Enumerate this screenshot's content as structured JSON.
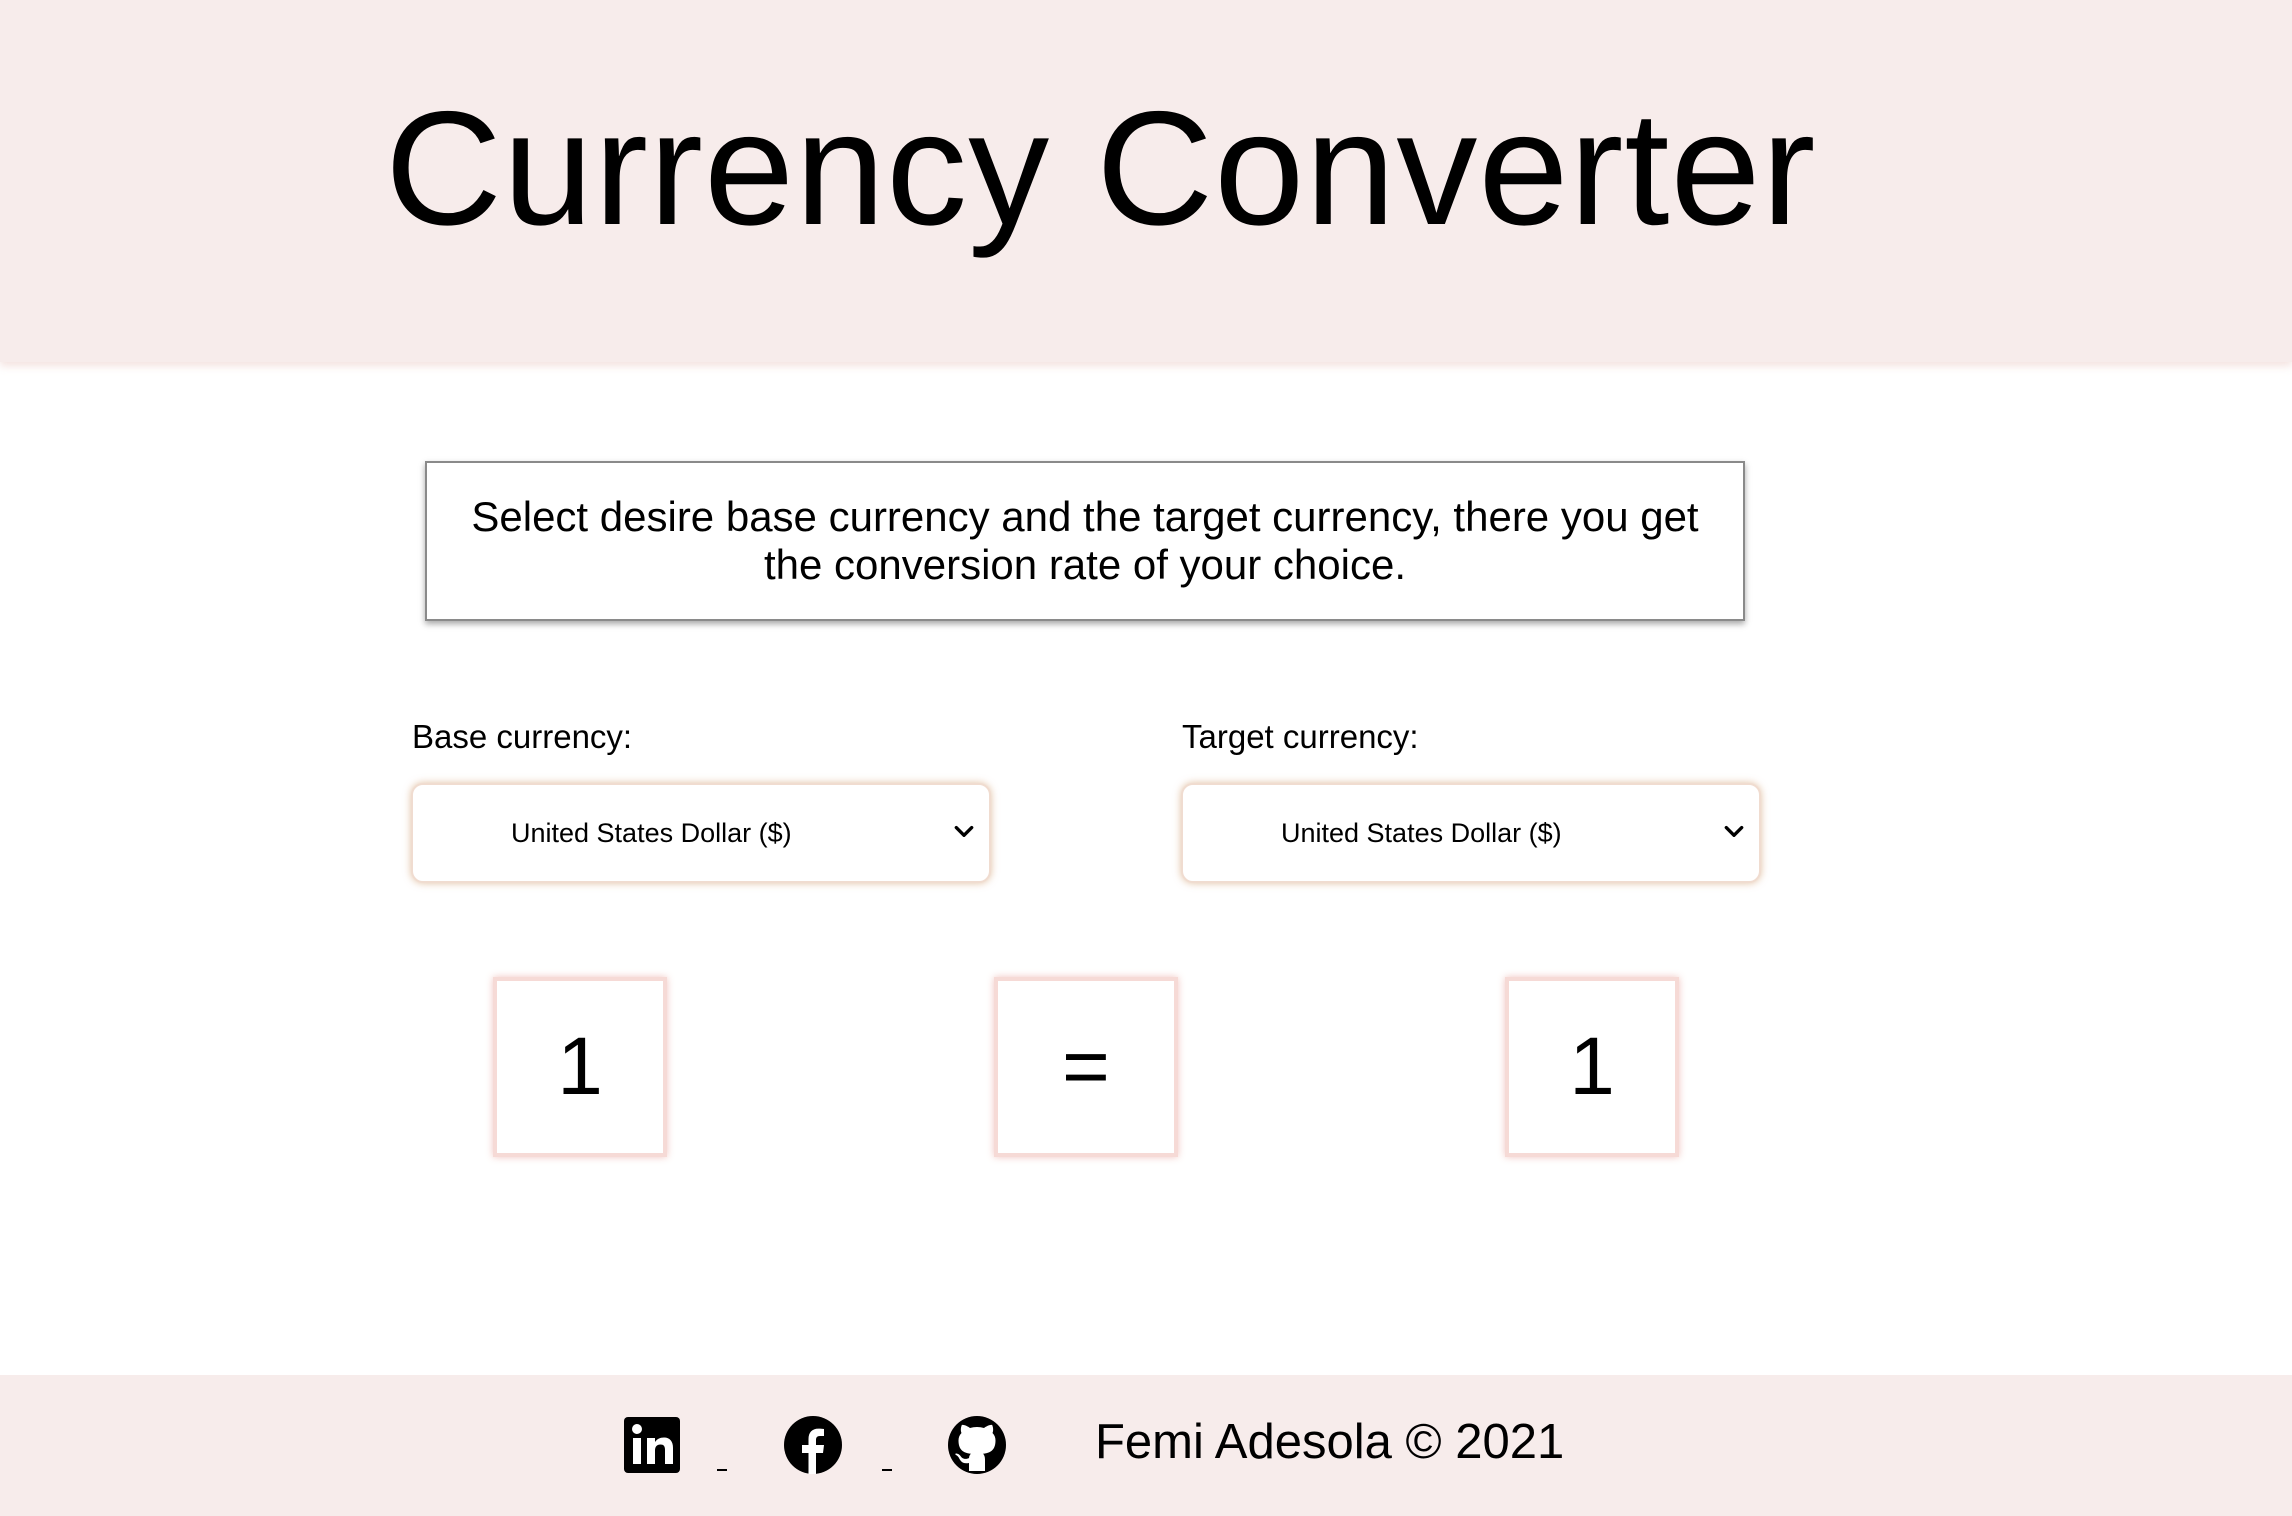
{
  "header": {
    "title": "Currency Converter"
  },
  "intro": {
    "text": "Select desire base currency and the target currency, there you get the conversion rate of your choice."
  },
  "base": {
    "label": "Base currency:",
    "selected": "United States Dollar ($)",
    "amount": "1"
  },
  "equals": "=",
  "target": {
    "label": "Target currency:",
    "selected": "United States Dollar ($)",
    "amount": "1"
  },
  "footer": {
    "social_icons": [
      "linkedin-icon",
      "facebook-icon",
      "github-icon"
    ],
    "copyright": "Femi Adesola © 2021"
  },
  "colors": {
    "header_bg": "#f7eceb",
    "footer_bg": "#f7eceb",
    "box_border": "#f6dad6"
  }
}
